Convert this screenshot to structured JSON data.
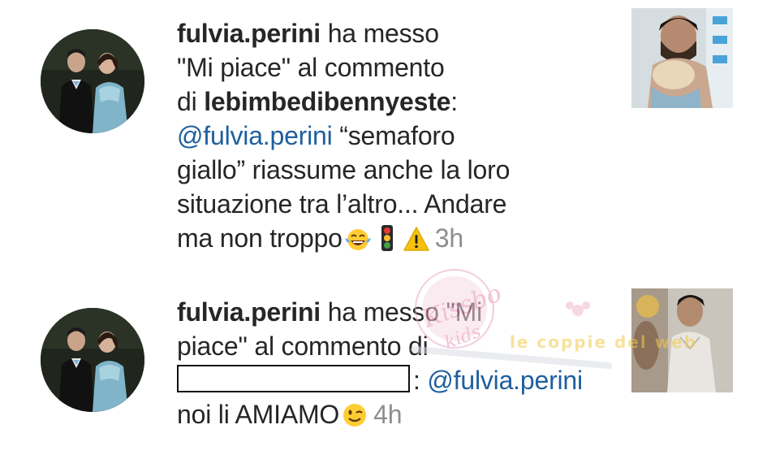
{
  "notifications": [
    {
      "username": "fulvia.perini",
      "text_a": " ha messo ",
      "text_b": "\"Mi piace\" al commento",
      "text_c": "di ",
      "comment_author": "lebimbedibennyeste",
      "after_author": ":",
      "mention": "@fulvia.perini",
      "comment_l1": " “semaforo",
      "comment_l2": "giallo” riassume anche la loro",
      "comment_l3": "situazione tra l’altro... Andare",
      "comment_l4": "ma non troppo",
      "emojis": [
        "laughing-tears-icon",
        "traffic-light-icon",
        "warning-icon"
      ],
      "time": "3h"
    },
    {
      "username": "fulvia.perini",
      "text_a": " ha messo \"Mi",
      "text_b": "piace\" al commento di",
      "after_author": ": ",
      "mention": "@fulvia.perini",
      "comment_l1": "noi li AMIAMO",
      "emojis": [
        "winking-face-icon"
      ],
      "time": "4h"
    }
  ],
  "watermark": {
    "script_text": "Kissbo kids",
    "banner_text": "le coppie del web"
  },
  "colors": {
    "text": "#262626",
    "mention": "#1e5f9e",
    "timestamp": "#8e8e8e",
    "watermark": "#e8a7c1"
  }
}
